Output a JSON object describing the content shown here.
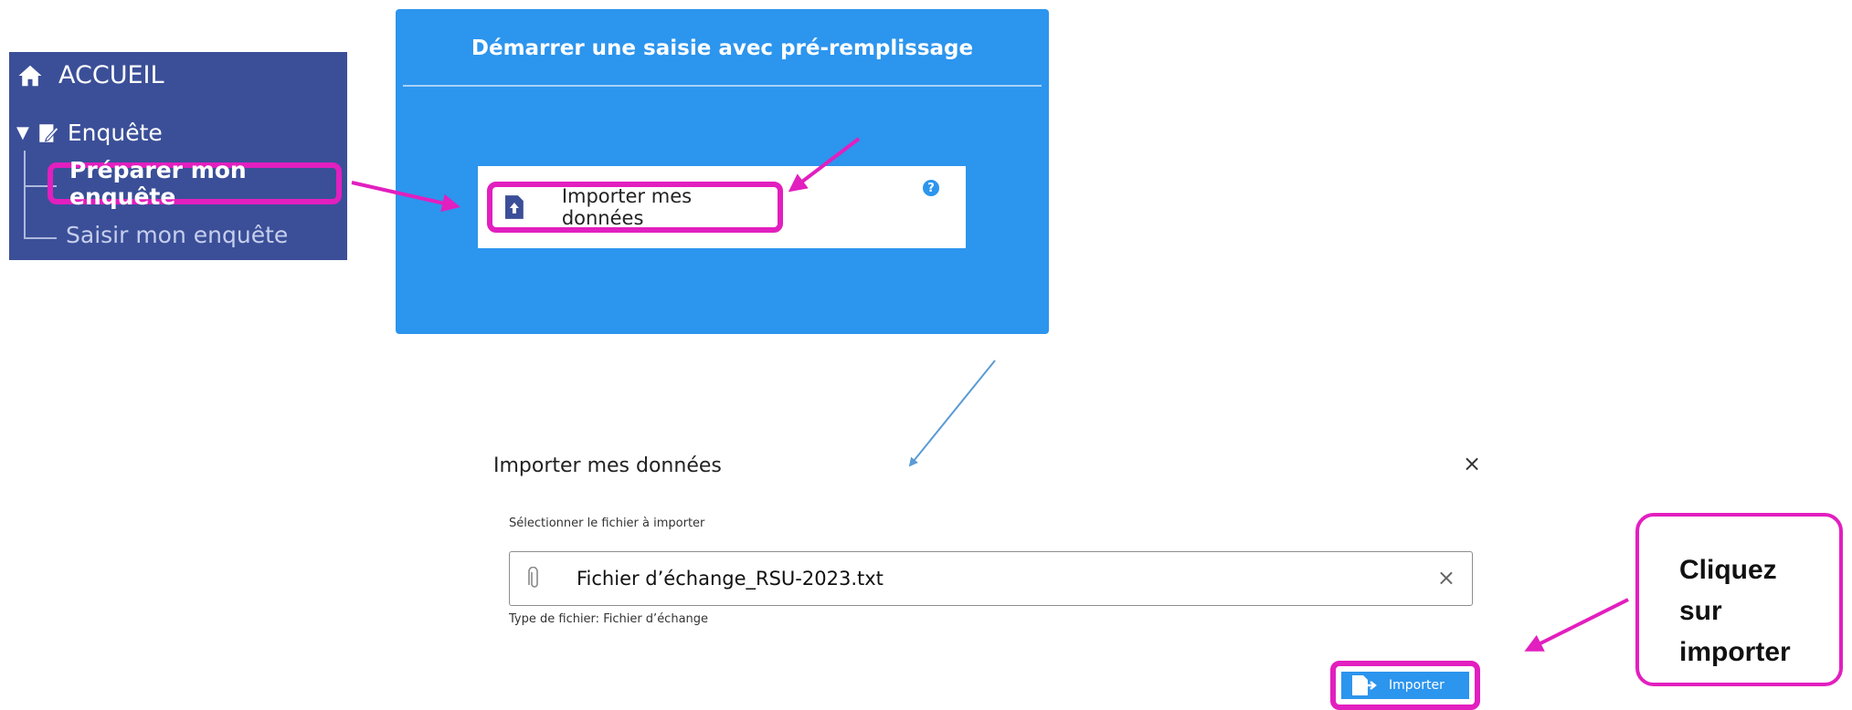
{
  "sidebar": {
    "home_label": "ACCUEIL",
    "home_icon": "home-icon",
    "section_label": "Enquête",
    "section_icon": "edit-document-icon",
    "items": [
      {
        "label": "Préparer mon enquête",
        "active": true
      },
      {
        "label": "Saisir mon enquête",
        "active": false
      }
    ],
    "bg_color": "#3b4f98"
  },
  "card": {
    "title": "Démarrer une saisie avec pré-remplissage",
    "import_button_label": "Importer mes données",
    "import_icon": "file-upload-icon",
    "help_icon": "help-icon",
    "help_glyph": "?",
    "bg_color": "#2c95ee"
  },
  "dialog": {
    "title": "Importer mes données",
    "close_glyph": "×",
    "select_label": "Sélectionner le fichier à importer",
    "file_name": "Fichier d’échange_RSU-2023.txt",
    "file_type": "Type de fichier: Fichier d’échange",
    "clear_glyph": "×",
    "import_label": "Importer"
  },
  "callout": {
    "lines": [
      "Cliquez",
      "sur",
      "importer"
    ]
  },
  "highlight_color": "#e21fbf"
}
